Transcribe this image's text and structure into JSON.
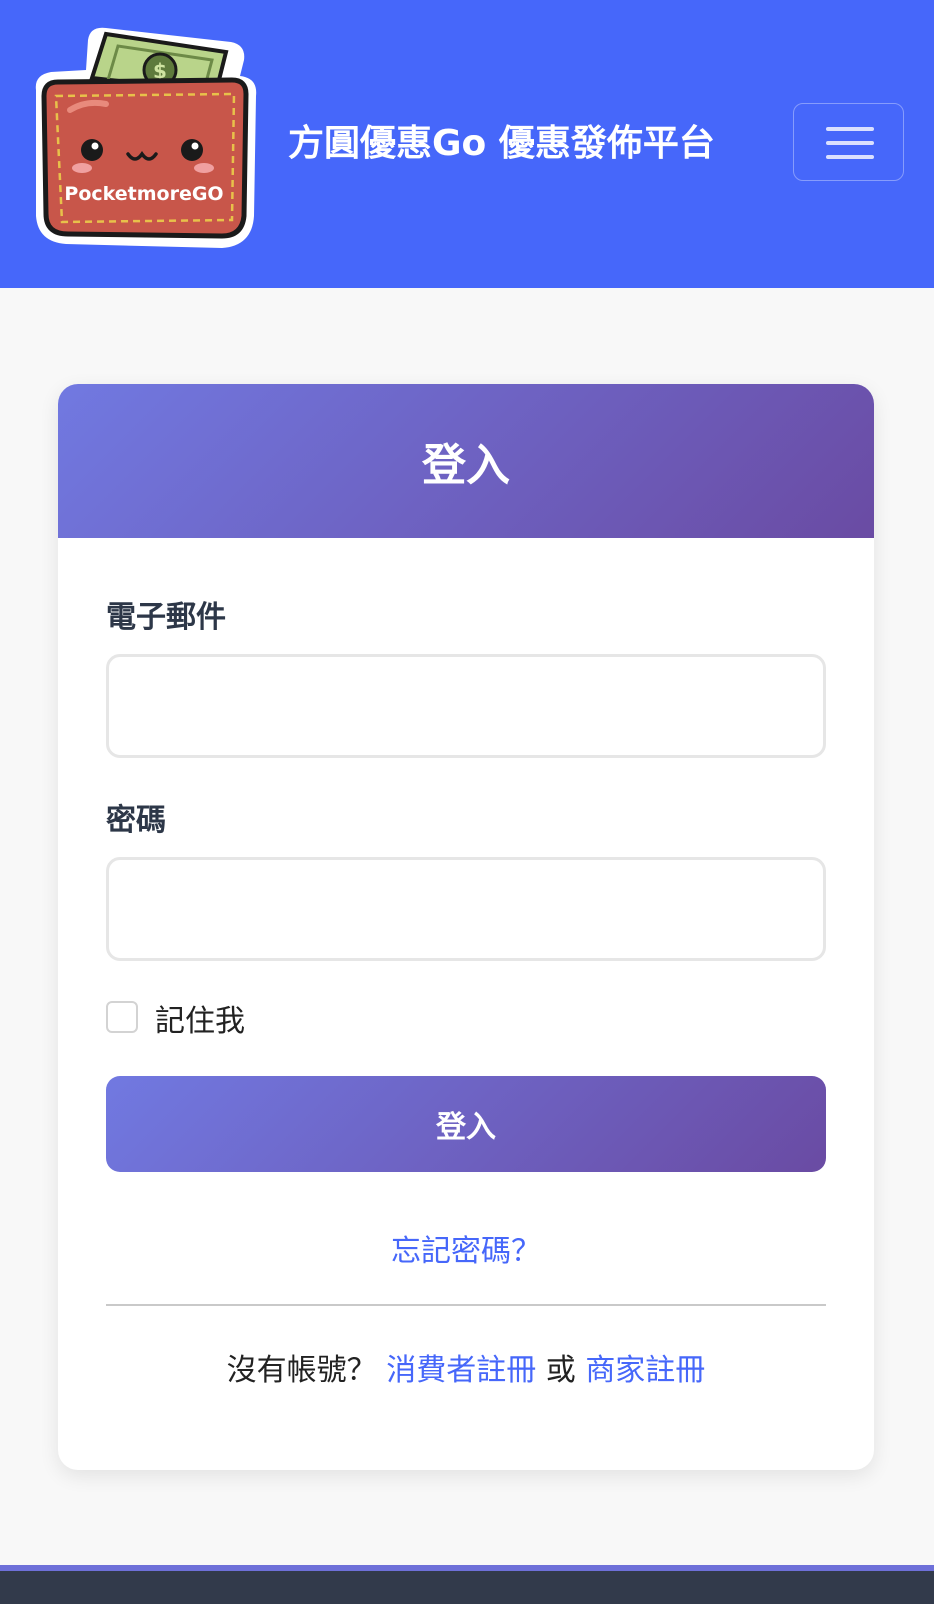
{
  "header": {
    "logo_text": "PocketmoreGO",
    "brand": "方圓優惠Go 優惠發佈平台",
    "menu_icon": "hamburger-icon",
    "color": "#4667fa"
  },
  "login_card": {
    "title": "登入",
    "email_label": "電子郵件",
    "email_value": "",
    "password_label": "密碼",
    "password_value": "",
    "remember_label": "記住我",
    "remember_checked": false,
    "submit_label": "登入",
    "forgot_password": "忘記密碼？",
    "no_account": "沒有帳號？",
    "consumer_register": "消費者註冊",
    "or": "或",
    "merchant_register": "商家註冊",
    "gradient_colors": [
      "#7179e1",
      "#6a4ba3"
    ]
  }
}
